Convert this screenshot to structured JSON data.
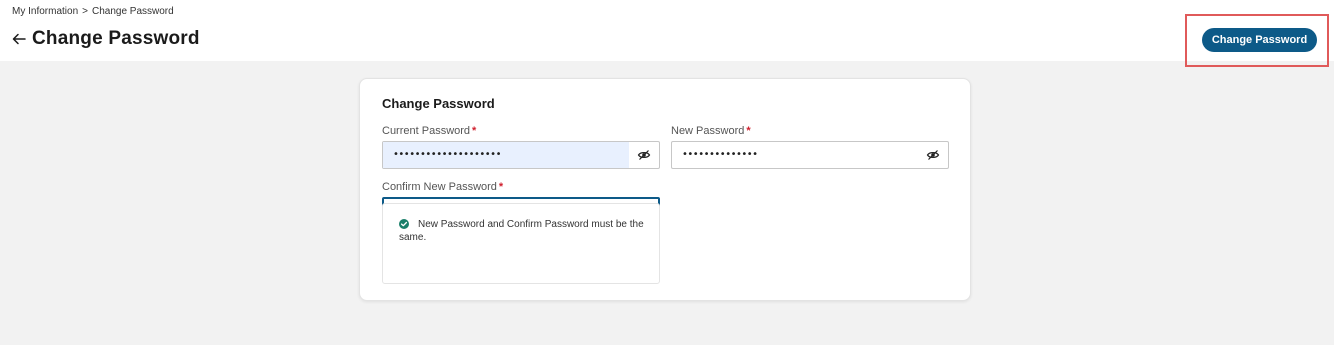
{
  "breadcrumb": {
    "parent": "My Information",
    "separator": ">",
    "current": "Change Password"
  },
  "header": {
    "title": "Change Password",
    "back_icon": "arrow-left-icon",
    "action_button": "Change Password"
  },
  "form": {
    "title": "Change Password",
    "required_marker": "*",
    "current_password": {
      "label": "Current Password",
      "masked_value": "••••••••••••••••••••"
    },
    "new_password": {
      "label": "New Password",
      "masked_value": "••••••••••••••"
    },
    "confirm_password": {
      "label": "Confirm New Password",
      "masked_value": "••••••••••••••"
    },
    "visibility_icon": "eye-slash-icon",
    "validation": {
      "icon": "check-circle-icon",
      "message": "New Password and Confirm Password must be the same."
    }
  },
  "colors": {
    "primary": "#0d5a88",
    "required": "#d0202e",
    "success": "#1a7f6a",
    "highlight": "#e05a5a",
    "autofill": "#e8f0fe"
  }
}
